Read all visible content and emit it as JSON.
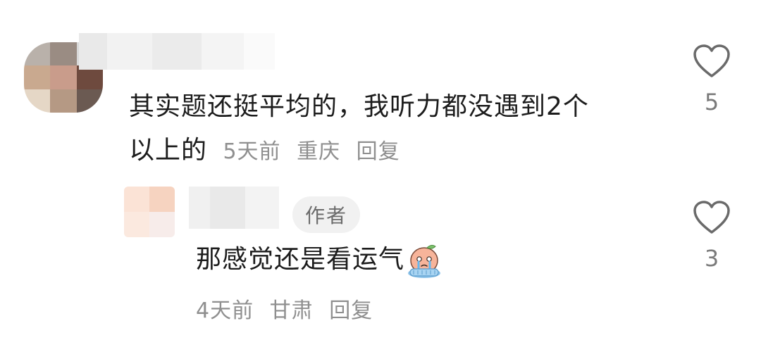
{
  "comment": {
    "text_line1": "其实题还挺平均的，我听力都没遇到2个",
    "text_line2": "以上的",
    "time": "5天前",
    "location": "重庆",
    "reply_label": "回复",
    "like_icon": "heart-icon",
    "like_count": "5"
  },
  "reply": {
    "author_badge": "作者",
    "text": "那感觉还是看运气",
    "emoji": "crying-peach-emoji",
    "time": "4天前",
    "location": "甘肃",
    "reply_label": "回复",
    "like_icon": "heart-icon",
    "like_count": "3"
  },
  "colors": {
    "text_primary": "#1c1c1c",
    "text_secondary": "#8f8f8f",
    "badge_bg": "#f1f1f1"
  }
}
